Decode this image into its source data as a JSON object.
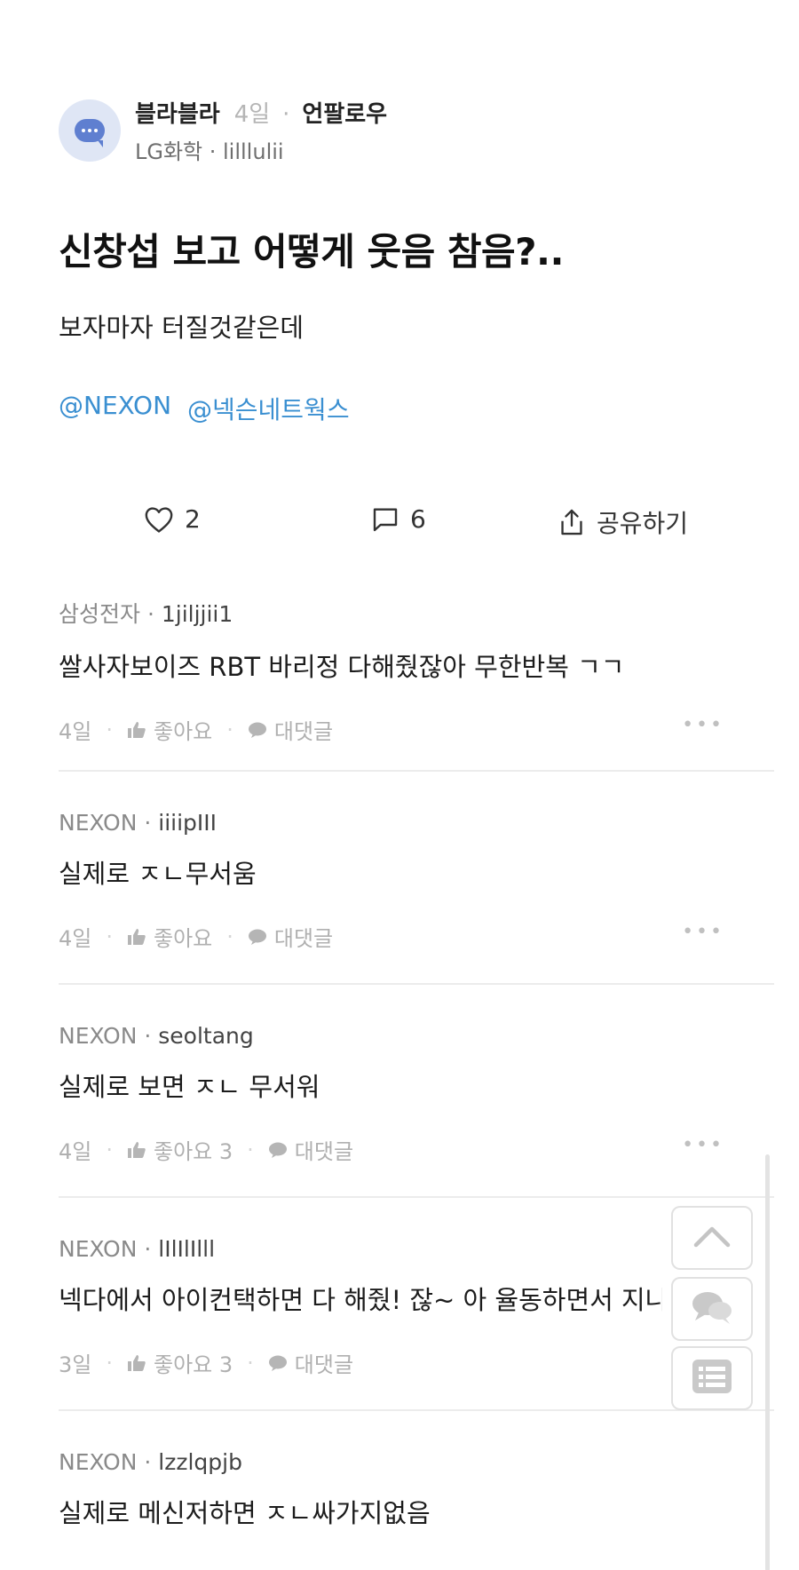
{
  "post": {
    "author": "블라블라",
    "age": "4일",
    "separator": "·",
    "unfollow_label": "언팔로우",
    "author_meta": "LG화학 · lilllulii",
    "title": "신창섭 보고 어떻게 웃음 참음?..",
    "body": "보자마자 터질것같은데",
    "tags": [
      "@NEXON",
      "@넥슨네트웍스"
    ]
  },
  "actions": {
    "like_count": "2",
    "comment_count": "6",
    "share_label": "공유하기"
  },
  "comments": [
    {
      "company": "삼성전자 · ",
      "nick": "1jiljjii1",
      "text": "쌀사자보이즈 RBT 바리정 다해줬잖아 무한반복 ㄱㄱ",
      "age": "4일",
      "like_label": "좋아요",
      "reply_label": "대댓글",
      "more": "•••"
    },
    {
      "company": "NEXON · ",
      "nick": "iiiipIII",
      "text": "실제로 ㅈㄴ무서움",
      "age": "4일",
      "like_label": "좋아요",
      "reply_label": "대댓글",
      "more": "•••"
    },
    {
      "company": "NEXON · ",
      "nick": "seoltang",
      "text": "실제로 보면 ㅈㄴ 무서워",
      "age": "4일",
      "like_label": "좋아요 3",
      "reply_label": "대댓글",
      "more": "•••"
    },
    {
      "company": "NEXON · ",
      "nick": "lIlIlIlll",
      "text": "넥다에서 아이컨택하면 다 해줬! 잖~ 아 율동하면서 지나감",
      "age": "3일",
      "like_label": "좋아요 3",
      "reply_label": "대댓글",
      "more": ""
    },
    {
      "company": "NEXON · ",
      "nick": "lzzlqpjb",
      "text": "실제로 메신저하면 ㅈㄴ싸가지없음",
      "age": "",
      "like_label": "",
      "reply_label": "",
      "more": ""
    }
  ],
  "colors": {
    "tag": "#3a8fd1",
    "avatar_bg": "#dfe6f5",
    "avatar_fg": "#5f7fd0",
    "meta_gray": "#8a8a8a"
  },
  "icons": {
    "like": "heart-outline-icon",
    "comment": "speech-bubble-outline-icon",
    "share": "share-upload-icon",
    "comment_like": "thumbs-up-icon",
    "comment_reply": "chat-bubble-icon",
    "float_up": "chevron-up-icon",
    "float_chat": "chat-bubbles-icon",
    "float_list": "list-icon"
  }
}
